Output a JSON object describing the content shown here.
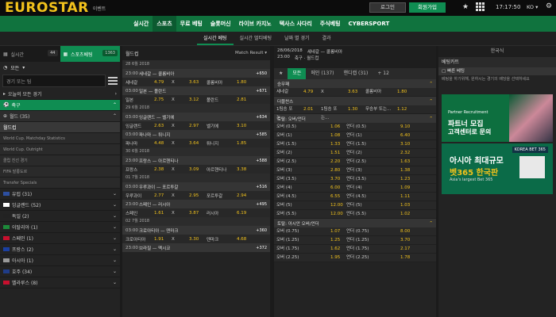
{
  "brand": {
    "logo_left": "EUR",
    "logo_mid": "O",
    "logo_right": "STAR",
    "event": "이벤트"
  },
  "topbar": {
    "login": "로그인",
    "signup": "회원가입",
    "time": "17:17:50",
    "lang": "KO"
  },
  "nav": {
    "items": [
      "실시간",
      "스포츠",
      "무료 베팅",
      "슬롯머신",
      "라이브 카지노",
      "텍사스 사다리",
      "주식베팅",
      "CYBERSPORT"
    ],
    "active": 1
  },
  "subnav": {
    "items": [
      "실시간 베팅",
      "실시간 멀티베팅",
      "날짜 별 경기",
      "결과"
    ],
    "active": 0
  },
  "left": {
    "tab_live": "실시간",
    "tab_live_count": "44",
    "tab_sports": "스포츠베팅",
    "tab_sports_count": "1363",
    "select": "모든",
    "search_placeholder": "경기 또는 팀",
    "all_today": "오늘의 모든 경기",
    "soccer": "축구",
    "worldcup": "월드 (35)",
    "worldcup_cup": "월드컵",
    "wc_items": [
      "World Cup. Matchday Statistics",
      "World Cup. Outright",
      "클럽 친선 경기",
      "FIFA 발롱도르",
      "Transfer Specials"
    ],
    "countries": [
      "유럽 (31)",
      "잉글랜드 (52)",
      "독일 (2)",
      "이탈리아 (1)",
      "스페인 (1)",
      "프랑스 (2)",
      "아시아 (1)",
      "호주 (34)",
      "벨라루스 (8)"
    ]
  },
  "middle": {
    "title": "월드컵",
    "result": "Match Result",
    "groups": [
      {
        "date": "28 6월 2018",
        "matches": [
          {
            "time": "23:00",
            "title": "세네갈 — 콜롬비아",
            "more": "+650",
            "odds": [
              "세네갈",
              "4.79",
              "X",
              "3.63",
              "콜롬비아",
              "1.80"
            ]
          },
          {
            "time": "03:00",
            "title": "일본 — 폴란드",
            "more": "+671",
            "odds": [
              "일본",
              "2.75",
              "X",
              "3.12",
              "폴란드",
              "2.81"
            ]
          }
        ]
      },
      {
        "date": "29 6월 2018",
        "matches": [
          {
            "time": "03:00",
            "title": "잉글랜드 — 벨기에",
            "more": "+634",
            "odds": [
              "잉글랜드",
              "2.63",
              "X",
              "2.97",
              "벨기에",
              "3.10"
            ]
          },
          {
            "time": "03:00",
            "title": "파나마 — 튀니지",
            "more": "+585",
            "odds": [
              "파나마",
              "4.48",
              "X",
              "3.64",
              "튀니지",
              "1.85"
            ]
          }
        ]
      },
      {
        "date": "30 6월 2018",
        "matches": [
          {
            "time": "23:00",
            "title": "프랑스 — 아르헨티나",
            "more": "+588",
            "odds": [
              "프랑스",
              "2.38",
              "X",
              "3.09",
              "아르헨티나",
              "3.38"
            ]
          }
        ]
      },
      {
        "date": "01 7월 2018",
        "matches": [
          {
            "time": "03:00",
            "title": "우루과이 — 포르투갈",
            "more": "+516",
            "odds": [
              "우루과이",
              "2.77",
              "X",
              "2.95",
              "포르투갈",
              "2.94"
            ]
          },
          {
            "time": "23:00",
            "title": "스페인 — 러시아",
            "more": "+495",
            "odds": [
              "스페인",
              "1.61",
              "X",
              "3.87",
              "러시아",
              "6.19"
            ]
          }
        ]
      },
      {
        "date": "02 7월 2018",
        "matches": [
          {
            "time": "03:00",
            "title": "크로아티아 — 덴마크",
            "more": "+360",
            "odds": [
              "크로아티아",
              "1.91",
              "X",
              "3.30",
              "덴마크",
              "4.68"
            ]
          },
          {
            "time": "23:00",
            "title": "브라질 — 멕시코",
            "more": "+372",
            "odds": []
          }
        ]
      }
    ]
  },
  "markets": {
    "date": "28/06/2018",
    "time": "23:00",
    "match": "세네갈 — 콜롬비아",
    "league": "축구 · 월드컵",
    "tabs": [
      "모든",
      "메인 (137)",
      "핸디캡 (31)",
      "+ 12"
    ],
    "result_title": "승무패",
    "result_row": [
      "세네갈",
      "4.79",
      "X",
      "3.63",
      "콜롬비아",
      "1.80"
    ],
    "dc_title": "더블찬스",
    "dc_row": [
      "1팀승 또는...",
      "2.01",
      "1팀승 또는...",
      "1.30",
      "무승부 또는...",
      "1.12"
    ],
    "ou_title": "토탈: 오버/언더",
    "ou_rows": [
      [
        "오버 (0.5)",
        "1.06",
        "언더 (0.5)",
        "9.10"
      ],
      [
        "오버 (1)",
        "1.08",
        "언더 (1)",
        "6.40"
      ],
      [
        "오버 (1.5)",
        "1.33",
        "언더 (1.5)",
        "3.10"
      ],
      [
        "오버 (2)",
        "1.51",
        "언더 (2)",
        "2.32"
      ],
      [
        "오버 (2.5)",
        "2.20",
        "언더 (2.5)",
        "1.63"
      ],
      [
        "오버 (3)",
        "2.80",
        "언더 (3)",
        "1.38"
      ],
      [
        "오버 (3.5)",
        "3.70",
        "언더 (3.5)",
        "1.23"
      ],
      [
        "오버 (4)",
        "6.00",
        "언더 (4)",
        "1.09"
      ],
      [
        "오버 (4.5)",
        "6.55",
        "언더 (4.5)",
        "1.11"
      ],
      [
        "오버 (5)",
        "12.00",
        "언더 (5)",
        "1.03"
      ],
      [
        "오버 (5.5)",
        "12.00",
        "언더 (5.5)",
        "1.02"
      ]
    ],
    "asian_title": "토탈: 아시안 오버/언더",
    "asian_rows": [
      [
        "오버 (0.75)",
        "1.07",
        "언더 (0.75)",
        "8.00"
      ],
      [
        "오버 (1.25)",
        "1.25",
        "언더 (1.25)",
        "3.70"
      ],
      [
        "오버 (1.75)",
        "1.62",
        "언더 (1.75)",
        "2.17"
      ],
      [
        "오버 (2.25)",
        "1.95",
        "언더 (2.25)",
        "1.78"
      ]
    ]
  },
  "right": {
    "lang": "한국식",
    "betslip": "베팅카트",
    "quick": "빠른 베팅",
    "msg": "베팅을 하기위해, 원하시는 경기의 배당을 선택하세요",
    "banner1": {
      "small": "Partner Recruitment",
      "line1": "파트너 모집",
      "line2": "고객센터로 문의"
    },
    "banner2": {
      "tag": "KOREA BET 365",
      "line1": "아시아 최대규모",
      "line2": "벳365 한국판",
      "line3": "Asia's largest Bet 365"
    }
  },
  "colors": {
    "accent": "#0f8d52",
    "logo": "#f2c21c",
    "odds": "#f2c21c"
  }
}
